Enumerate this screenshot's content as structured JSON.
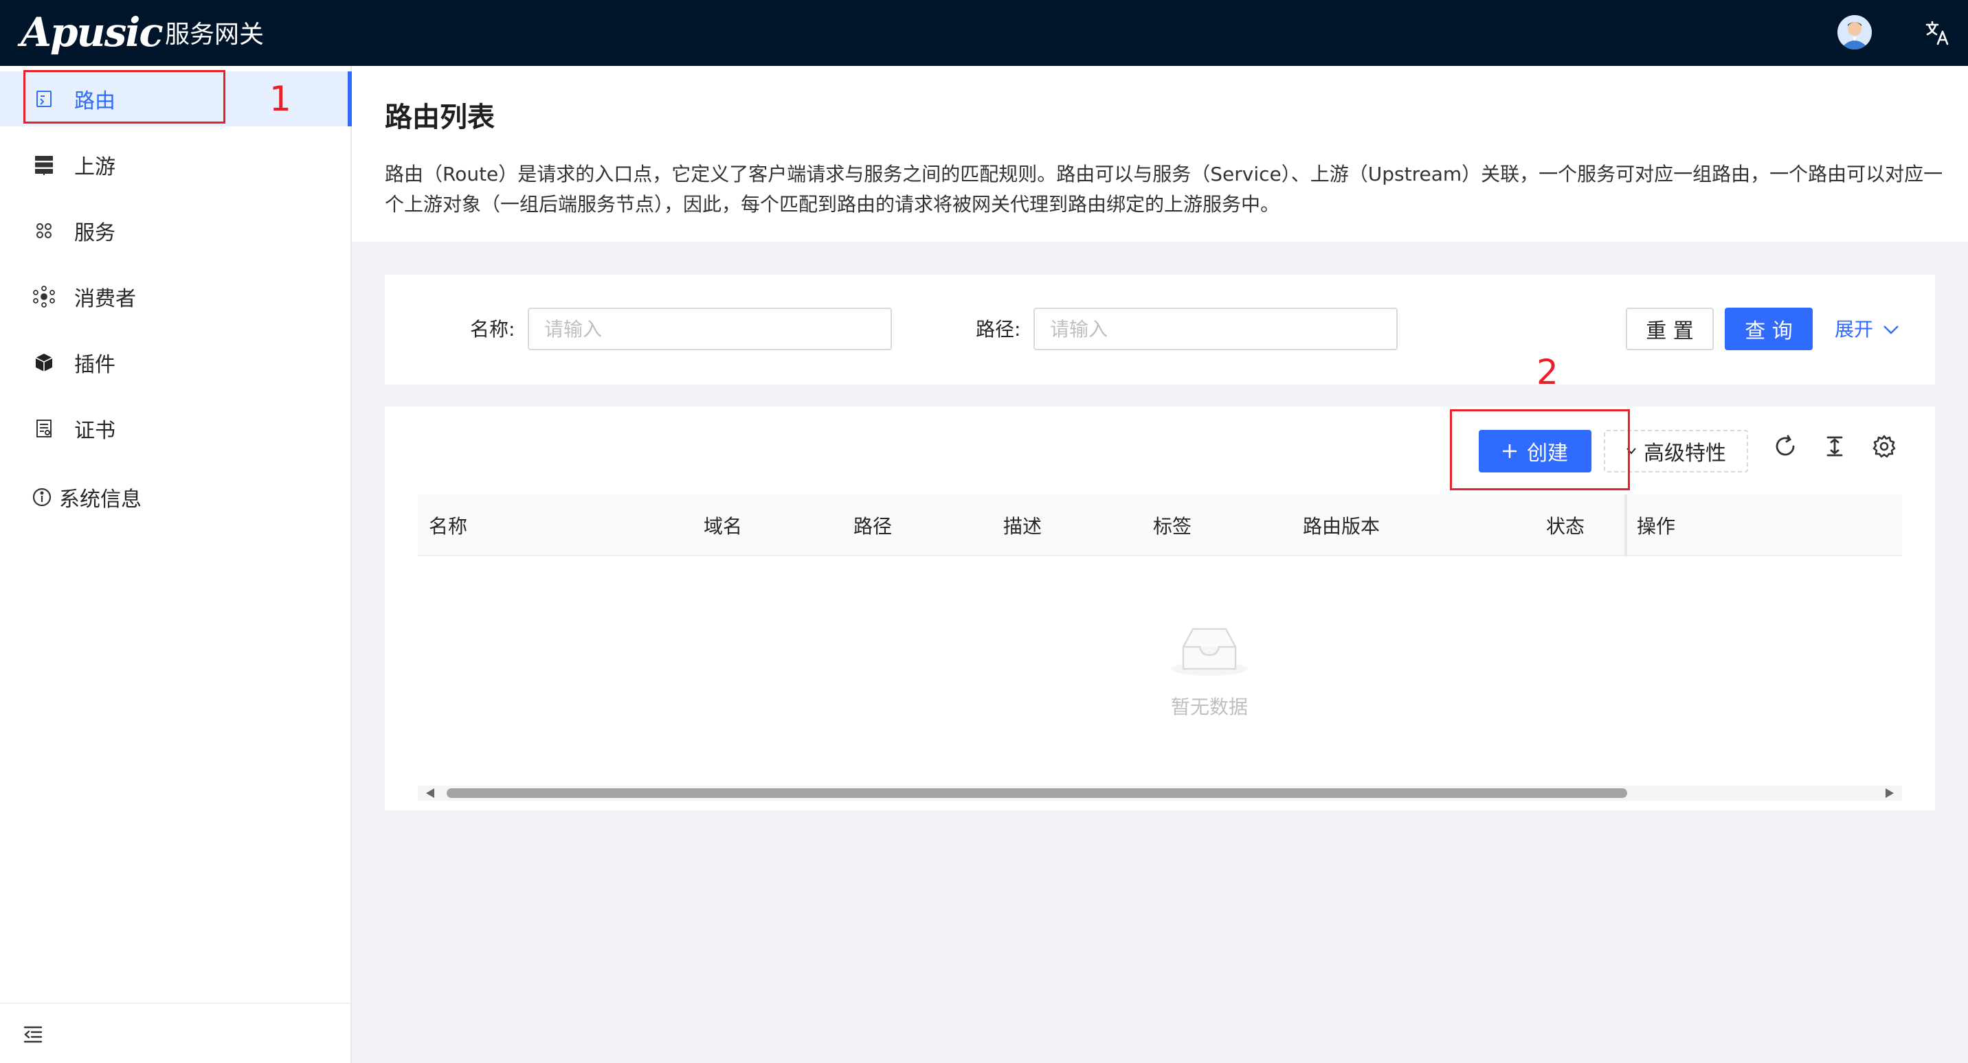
{
  "header": {
    "logo": "Apusic",
    "app_title": "服务网关",
    "avatar_icon": "user-avatar-icon",
    "language_icon": "translate-icon"
  },
  "sidebar": {
    "items": [
      {
        "label": "路由",
        "icon": "route-icon",
        "active": true
      },
      {
        "label": "上游",
        "icon": "server-icon",
        "active": false
      },
      {
        "label": "服务",
        "icon": "service-icon",
        "active": false
      },
      {
        "label": "消费者",
        "icon": "consumer-icon",
        "active": false
      },
      {
        "label": "插件",
        "icon": "plugin-icon",
        "active": false
      },
      {
        "label": "证书",
        "icon": "certificate-icon",
        "active": false
      }
    ],
    "system_info": "系统信息",
    "collapse_icon": "menu-fold-icon"
  },
  "annotations": {
    "one": "1",
    "two": "2",
    "color": "#e8202a"
  },
  "page": {
    "title": "路由列表",
    "description": "路由（Route）是请求的入口点，它定义了客户端请求与服务之间的匹配规则。路由可以与服务（Service）、上游（Upstream）关联，一个服务可对应一组路由，一个路由可以对应一个上游对象（一组后端服务节点），因此，每个匹配到路由的请求将被网关代理到路由绑定的上游服务中。"
  },
  "search": {
    "name_label": "名称:",
    "name_placeholder": "请输入",
    "path_label": "路径:",
    "path_placeholder": "请输入",
    "reset_label": "重 置",
    "query_label": "查 询",
    "expand_label": "展开"
  },
  "toolbar": {
    "create_label": "创建",
    "advanced_label": "高级特性"
  },
  "table": {
    "columns": [
      "名称",
      "域名",
      "路径",
      "描述",
      "标签",
      "路由版本",
      "状态",
      "操作"
    ],
    "rows": [],
    "empty_text": "暂无数据"
  },
  "colors": {
    "header_bg": "#001529",
    "primary": "#2f6bff",
    "active_bg": "#e6f0ff"
  }
}
